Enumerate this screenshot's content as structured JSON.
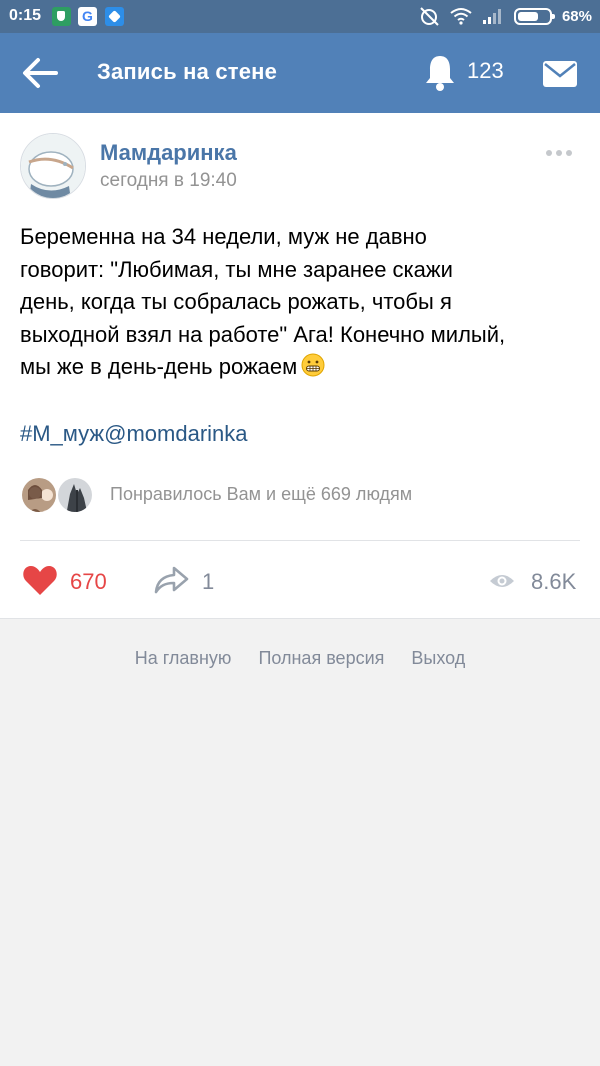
{
  "status_bar": {
    "time": "0:15",
    "battery_percent": "68%",
    "battery_level": 0.68
  },
  "header": {
    "title": "Запись на стене",
    "notifications_count": "123"
  },
  "post": {
    "author": "Мамдаринка",
    "date": "сегодня в 19:40",
    "text_lines": [
      "Беременна на 34 недели, муж не давно",
      "говорит: \"Любимая, ты мне заранее скажи",
      "день, когда ты собралась рожать, чтобы я",
      "выходной взял на работе\" Ага! Конечно милый,",
      "мы же в день-день рожаем"
    ],
    "hashtag": "#М_муж@momdarinka",
    "likers_text": "Понравилось Вам и ещё 669 людям",
    "likes": "670",
    "shares": "1",
    "views": "8.6K"
  },
  "footer": {
    "links": [
      "На главную",
      "Полная версия",
      "Выход"
    ]
  },
  "colors": {
    "header_bg": "#5181b8",
    "status_bg": "#4c6f95",
    "author": "#4a76a8",
    "like": "#e64646",
    "link": "#2a5885",
    "muted": "#828a99"
  }
}
